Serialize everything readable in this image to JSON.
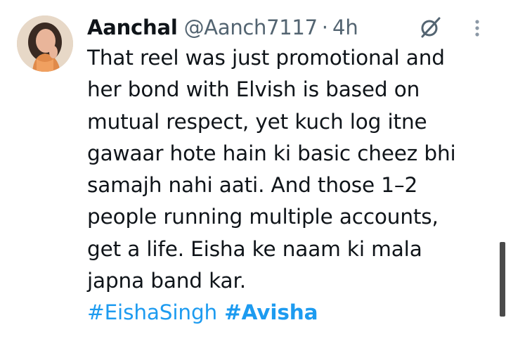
{
  "tweet": {
    "display_name": "Aanchal",
    "handle": "@Aanch7117",
    "separator": "·",
    "time": "4h",
    "lines": [
      "That reel was just promotional and",
      "her bond with Elvish is based on",
      "mutual respect, yet kuch log itne",
      "gawaar hote hain ki basic cheez bhi",
      "samajh nahi aati. And those 1–2",
      "people running multiple accounts,",
      "get a life. Eisha ke naam ki mala",
      "japna band kar."
    ],
    "hashtags": [
      "#EishaSingh",
      "#Avisha"
    ]
  },
  "icons": {
    "grok": "grok-icon",
    "more": "more-vertical-icon",
    "avatar": "avatar"
  },
  "colors": {
    "text": "#0f1419",
    "secondary": "#536471",
    "link": "#1d9bf0"
  }
}
